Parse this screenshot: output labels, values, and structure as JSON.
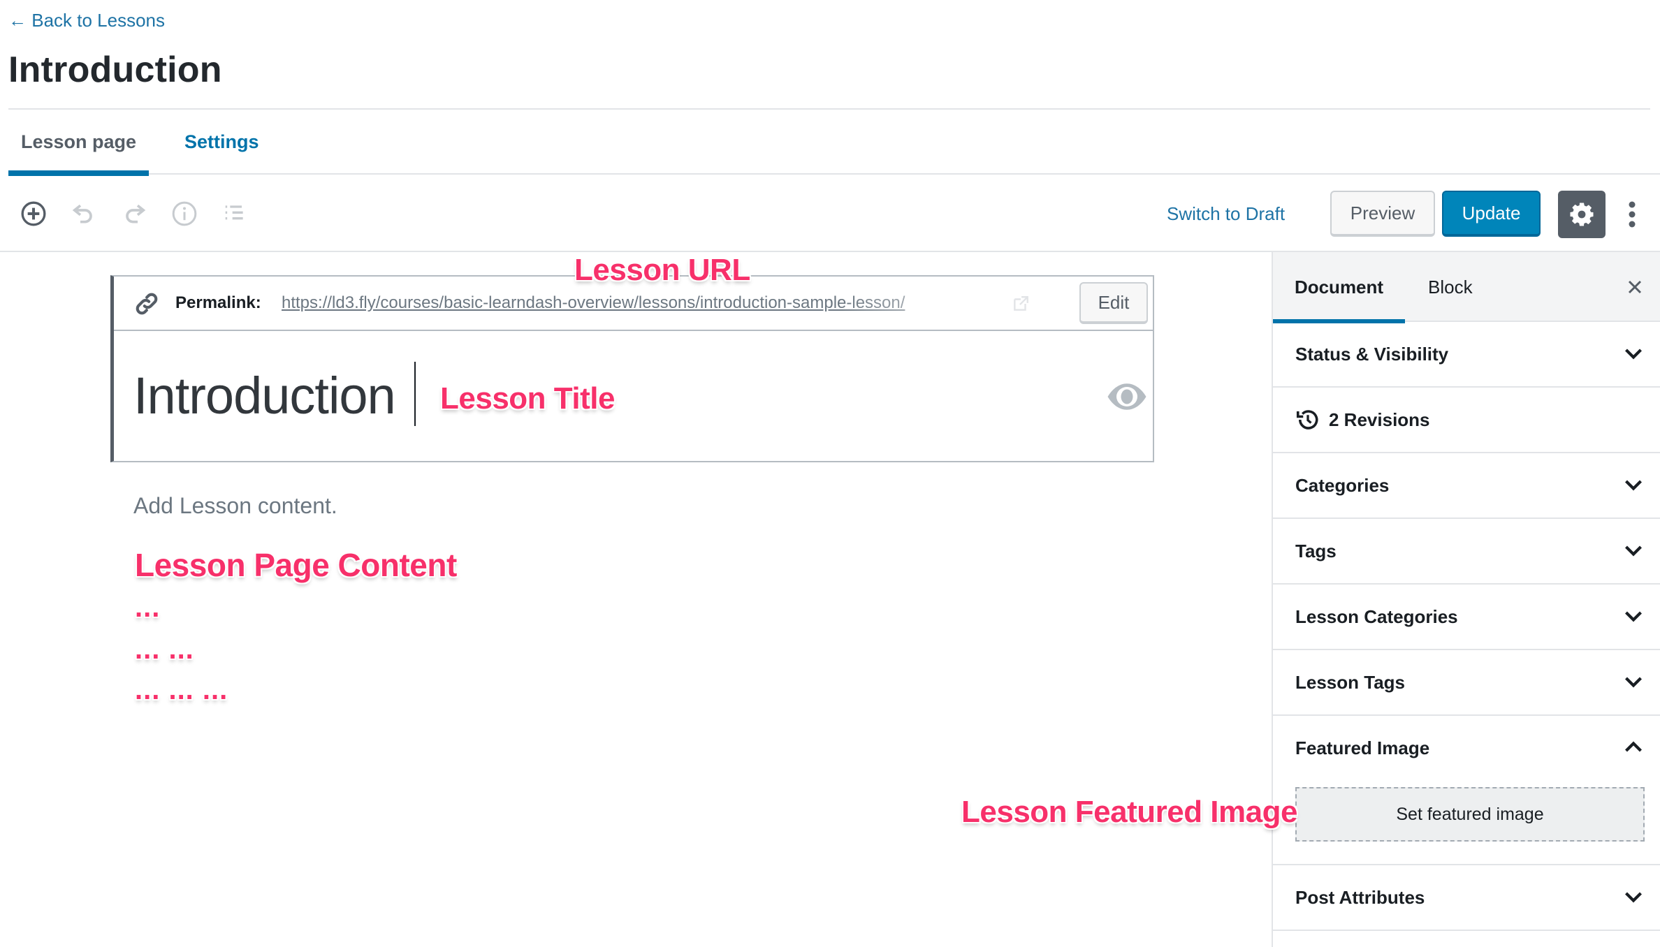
{
  "header": {
    "back_link": "← Back to Lessons",
    "page_title": "Introduction"
  },
  "tabs": [
    {
      "label": "Lesson page",
      "active": true
    },
    {
      "label": "Settings",
      "active": false
    }
  ],
  "toolbar": {
    "icons": [
      "add-block-icon",
      "undo-icon",
      "redo-icon",
      "info-icon",
      "outline-icon"
    ],
    "switch_to_draft": "Switch to Draft",
    "preview": "Preview",
    "update": "Update",
    "settings_icon": "gear-icon",
    "more_icon": "more-vertical-icon"
  },
  "editor": {
    "permalink_label": "Permalink:",
    "permalink_url": "https://ld3.fly/courses/basic-learndash-overview/lessons/introduction-sample-lesson/",
    "edit_button": "Edit",
    "title_value": "Introduction",
    "content_placeholder": "Add Lesson content."
  },
  "annotations": {
    "lesson_url": "Lesson URL",
    "lesson_title": "Lesson Title",
    "lesson_page_content": "Lesson Page Content",
    "dots_1": "...",
    "dots_2": "... ...",
    "dots_3": "... ... ...",
    "lesson_featured_image": "Lesson Featured Image"
  },
  "sidebar": {
    "tabs": [
      {
        "label": "Document",
        "active": true
      },
      {
        "label": "Block",
        "active": false
      }
    ],
    "close_icon": "close-icon",
    "panels": [
      {
        "title": "Status & Visibility",
        "expanded": false
      },
      {
        "title": "2 Revisions",
        "icon": "revisions-icon"
      },
      {
        "title": "Categories",
        "expanded": false
      },
      {
        "title": "Tags",
        "expanded": false
      },
      {
        "title": "Lesson Categories",
        "expanded": false
      },
      {
        "title": "Lesson Tags",
        "expanded": false
      },
      {
        "title": "Featured Image",
        "expanded": true,
        "button": "Set featured image"
      },
      {
        "title": "Post Attributes",
        "expanded": false
      }
    ]
  },
  "colors": {
    "accent": "#0073aa",
    "update_button": "#0085ba",
    "annotation": "#f7306a",
    "gear_button": "#555d66"
  }
}
